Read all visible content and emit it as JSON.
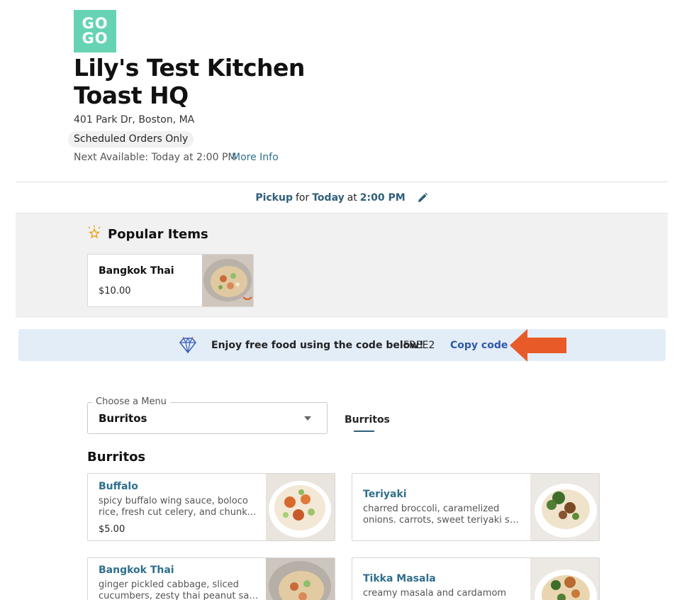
{
  "restaurant": {
    "logo_line1": "GO",
    "logo_line2": "GO",
    "name_line1": "Lily's Test Kitchen",
    "name_line2": "Toast HQ",
    "address": "401 Park Dr, Boston, MA",
    "scheduled_badge": "Scheduled Orders Only",
    "next_available": "Next Available: Today at 2:00 PM",
    "more_info": "More Info"
  },
  "pickup": {
    "mode": "Pickup",
    "for_text": "for",
    "day": "Today",
    "at_text": "at",
    "time": "2:00 PM",
    "edit_icon": "pencil-icon"
  },
  "popular": {
    "title": "Popular Items",
    "icon": "star-icon",
    "items": [
      {
        "name": "Bangkok Thai",
        "price": "$10.00"
      }
    ]
  },
  "promo": {
    "icon": "diamond-icon",
    "text": "Enjoy free food using the code below!",
    "code": "FREE2",
    "copy_label": "Copy code",
    "arrow_color": "#e85a27"
  },
  "menu": {
    "select_label": "Choose a Menu",
    "select_value": "Burritos",
    "tabs": [
      {
        "label": "Burritos",
        "active": true
      }
    ],
    "section_title": "Burritos",
    "items": [
      {
        "name": "Buffalo",
        "desc_line1": "spicy buffalo wing sauce, boloco",
        "desc_line2": "rice, fresh cut celery, and chunky…",
        "price": "$5.00"
      },
      {
        "name": "Teriyaki",
        "desc_line1": "charred broccoli, caramelized",
        "desc_line2": "onions. carrots, sweet teriyaki sau…",
        "price": ""
      },
      {
        "name": "Bangkok Thai",
        "desc_line1": "ginger pickled cabbage, sliced",
        "desc_line2": "cucumbers, zesty thai peanut sauc…",
        "price": ""
      },
      {
        "name": "Tikka Masala",
        "desc_line1": "creamy masala and cardamom",
        "desc_line2": "",
        "price": ""
      }
    ]
  },
  "colors": {
    "brand_teal": "#66d3b4",
    "link_blue": "#2f6f8e",
    "promo_bg": "#e2edf8"
  }
}
